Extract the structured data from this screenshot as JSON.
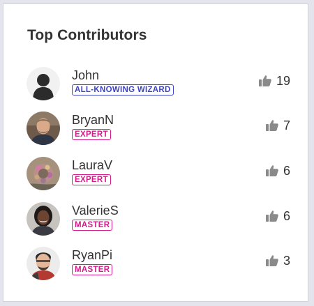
{
  "widget": {
    "title": "Top Contributors"
  },
  "contributors": [
    {
      "name": "John",
      "rank": "ALL-KNOWING WIZARD",
      "likes": "19",
      "avatar": "default-silhouette"
    },
    {
      "name": "BryanN",
      "rank": "EXPERT",
      "likes": "7",
      "avatar": "user-photo"
    },
    {
      "name": "LauraV",
      "rank": "EXPERT",
      "likes": "6",
      "avatar": "user-photo"
    },
    {
      "name": "ValerieS",
      "rank": "MASTER",
      "likes": "6",
      "avatar": "user-photo"
    },
    {
      "name": "RyanPi",
      "rank": "MASTER",
      "likes": "3",
      "avatar": "user-photo"
    }
  ],
  "colors": {
    "wizard_badge": "#3d45c2",
    "rank_badge": "#d6198d",
    "thumb_icon": "#8a8a8a"
  },
  "icons": {
    "likes": "thumbs-up-icon"
  }
}
